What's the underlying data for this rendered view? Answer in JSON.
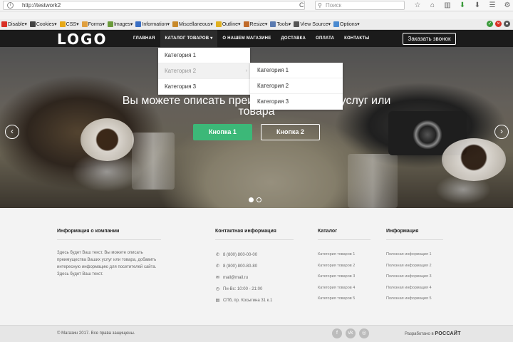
{
  "browser": {
    "url": "http://testwork2",
    "search_placeholder": "Поиск",
    "reload_icon": "C"
  },
  "devbar": {
    "items": [
      {
        "label": "Disable▾",
        "color": "#d93025"
      },
      {
        "label": "Cookies▾",
        "color": "#444444"
      },
      {
        "label": "CSS▾",
        "color": "#e6a817"
      },
      {
        "label": "Forms▾",
        "color": "#e0a040"
      },
      {
        "label": "Images▾",
        "color": "#6a9a3a"
      },
      {
        "label": "Information▾",
        "color": "#3a6fc4"
      },
      {
        "label": "Miscellaneous▾",
        "color": "#c8892a"
      },
      {
        "label": "Outline▾",
        "color": "#e0b020"
      },
      {
        "label": "Resize▾",
        "color": "#c06a2a"
      },
      {
        "label": "Tools▾",
        "color": "#5a7ab0"
      },
      {
        "label": "View Source▾",
        "color": "#555555"
      },
      {
        "label": "Options▾",
        "color": "#4a8ad0"
      }
    ]
  },
  "header": {
    "logo": "LOGO",
    "nav": [
      "ГЛАВНАЯ",
      "КАТАЛОГ ТОВАРОВ ▾",
      "О НАШЕМ МАГАЗИНЕ",
      "ДОСТАВКА",
      "ОПЛАТА",
      "КОНТАКТЫ"
    ],
    "call_button": "Заказать звонок"
  },
  "dropdown": {
    "level1": [
      "Категория 1",
      "Категория 2",
      "Категория 3"
    ],
    "level2": [
      "Категория 1",
      "Категория 2",
      "Категория 3"
    ]
  },
  "hero": {
    "title_line1": "Вы можете описать преи",
    "title_line1_tail": "к услуг или",
    "title_line2": "товара",
    "button1": "Кнопка 1",
    "button2": "Кнопка 2",
    "slides": 2,
    "active_slide": 1
  },
  "footer": {
    "company": {
      "title": "Информация о компании",
      "text": "Здесь будет Ваш текст. Вы можете описать преимущества Ваших услуг или товара, добавить интересную информацию для посетителей сайта. Здесь будет Ваш текст."
    },
    "contacts": {
      "title": "Контактная информация",
      "lines": [
        {
          "icon": "phone-icon",
          "glyph": "✆",
          "text": "8 (800) 800-00-00"
        },
        {
          "icon": "phone-icon",
          "glyph": "✆",
          "text": "8 (800) 800-80-80"
        },
        {
          "icon": "mail-icon",
          "glyph": "✉",
          "text": "mail@mail.ru"
        },
        {
          "icon": "clock-icon",
          "glyph": "◷",
          "text": "Пн-Вс: 10:00 - 21:00"
        },
        {
          "icon": "map-icon",
          "glyph": "▤",
          "text": "СПб, пр. Косыгина 31 к.1"
        }
      ]
    },
    "catalog": {
      "title": "Каталог",
      "links": [
        "Категория товаров 1",
        "Категория товаров 2",
        "Категория товаров 3",
        "Категория товаров 4",
        "Категория товаров 5"
      ]
    },
    "info": {
      "title": "Информация",
      "links": [
        "Полезная информация 1",
        "Полезная информация 2",
        "Полезная информация 3",
        "Полезная информация 4",
        "Полезная информация 5"
      ]
    },
    "copyright": "© Магазин 2017. Все права защищены.",
    "dev_prefix": "Разработано в",
    "dev_brand": "РОССАЙТ"
  }
}
